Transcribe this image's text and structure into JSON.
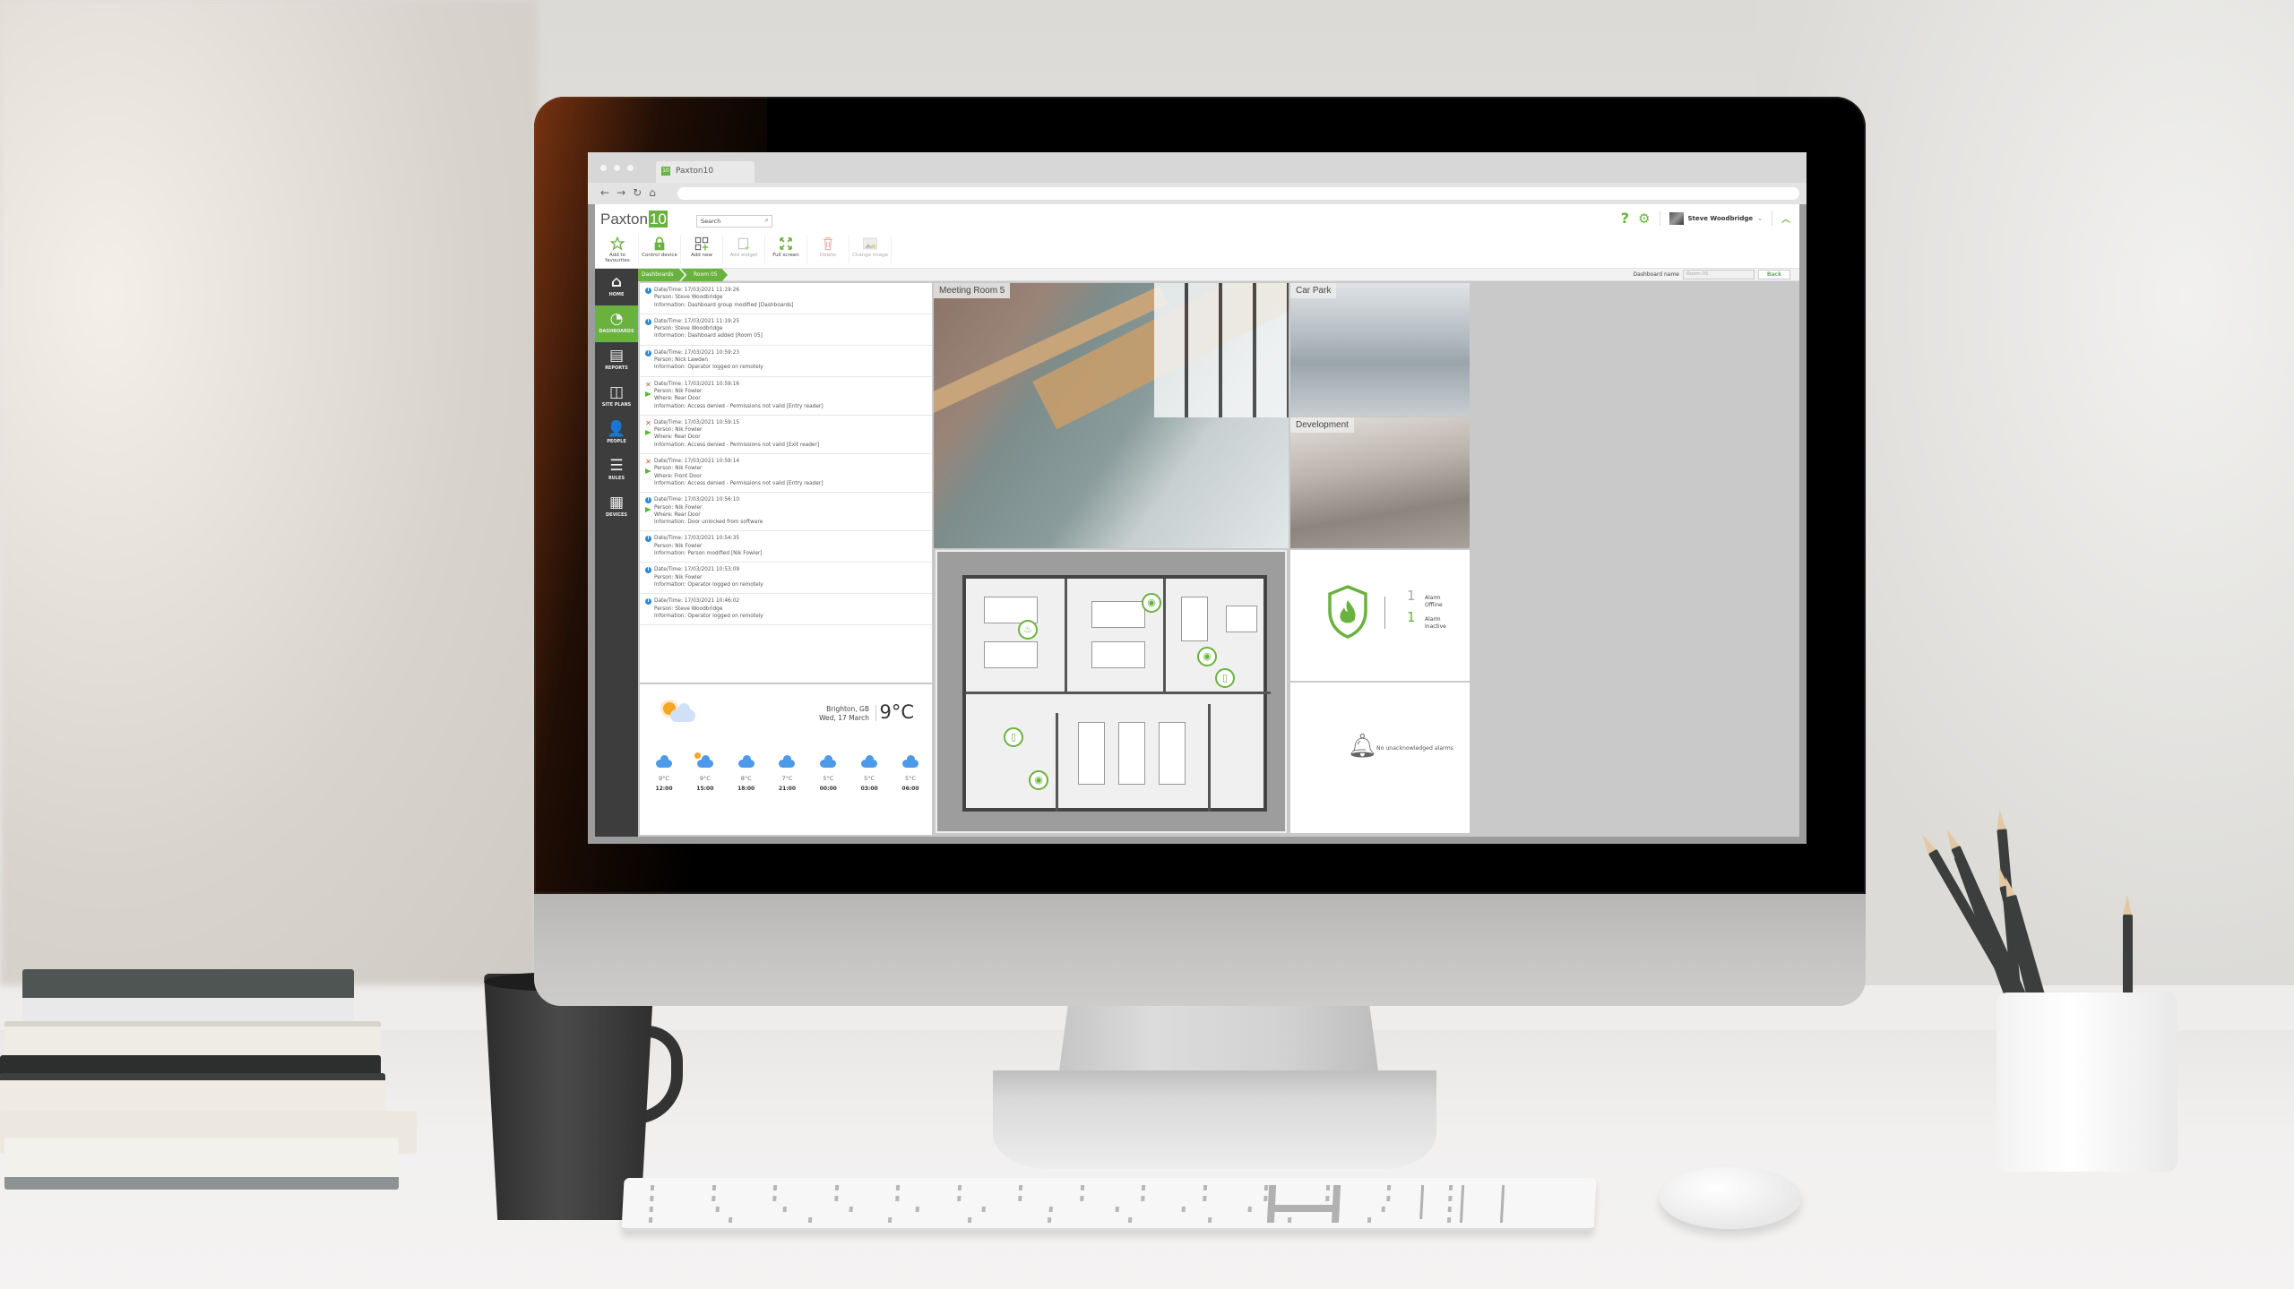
{
  "browser": {
    "tab_title": "Paxton10",
    "tab_favicon": "10",
    "nav": {
      "back": "←",
      "forward": "→",
      "reload": "↻",
      "home": "⌂"
    }
  },
  "app": {
    "logo_text": "Paxton",
    "logo_number": "10",
    "search_placeholder": "Search",
    "toolbar": [
      {
        "label": "Add to favourites",
        "icon": "star-icon",
        "enabled": true
      },
      {
        "label": "Control device",
        "icon": "lock-icon",
        "enabled": true
      },
      {
        "label": "Add new",
        "icon": "add-grid-icon",
        "enabled": true
      },
      {
        "label": "Add widget",
        "icon": "add-widget-icon",
        "enabled": false
      },
      {
        "label": "Full screen",
        "icon": "fullscreen-icon",
        "enabled": true
      },
      {
        "label": "Delete",
        "icon": "trash-icon",
        "enabled": false
      },
      {
        "label": "Change image",
        "icon": "image-icon",
        "enabled": false
      }
    ],
    "user_name": "Steve Woodbridge",
    "help_icon": "?",
    "accent_color": "#6ab23e"
  },
  "sidebar": {
    "items": [
      {
        "label": "HOME",
        "icon": "⌂",
        "active": false
      },
      {
        "label": "DASHBOARDS",
        "icon": "◔",
        "active": true
      },
      {
        "label": "REPORTS",
        "icon": "▤",
        "active": false
      },
      {
        "label": "SITE PLANS",
        "icon": "◫",
        "active": false
      },
      {
        "label": "PEOPLE",
        "icon": "👤",
        "active": false
      },
      {
        "label": "RULES",
        "icon": "☰",
        "active": false
      },
      {
        "label": "DEVICES",
        "icon": "▦",
        "active": false
      }
    ]
  },
  "breadcrumb": [
    "Dashboards",
    "Room 05"
  ],
  "dashboard": {
    "name_label": "Dashboard name",
    "name_value": "Room 05",
    "back_label": "Back"
  },
  "events": [
    {
      "type": "info",
      "lines": [
        "Date/Time: 17/03/2021 11:19:26",
        "Person: Steve Woodbridge",
        "Information: Dashboard group modified [Dashboards]"
      ]
    },
    {
      "type": "info",
      "lines": [
        "Date/Time: 17/03/2021 11:19:25",
        "Person: Steve Woodbridge",
        "Information: Dashboard added [Room 05]"
      ]
    },
    {
      "type": "info",
      "lines": [
        "Date/Time: 17/03/2021 10:59:23",
        "Person: Nick Lawden",
        "Information: Operator logged on remotely"
      ]
    },
    {
      "type": "denied",
      "lines": [
        "Date/Time: 17/03/2021 10:59:16",
        "Person: Nik Fowler",
        "Where: Rear Door",
        "Information: Access denied - Permissions not valid [Entry reader]"
      ]
    },
    {
      "type": "denied",
      "lines": [
        "Date/Time: 17/03/2021 10:59:15",
        "Person: Nik Fowler",
        "Where: Rear Door",
        "Information: Access denied - Permissions not valid [Exit reader]"
      ]
    },
    {
      "type": "denied",
      "lines": [
        "Date/Time: 17/03/2021 10:59:14",
        "Person: Nik Fowler",
        "Where: Front Door",
        "Information: Access denied - Permissions not valid [Entry reader]"
      ]
    },
    {
      "type": "info-door",
      "lines": [
        "Date/Time: 17/03/2021 10:56:10",
        "Person: Nik Fowler",
        "Where: Rear Door",
        "Information: Door unlocked from software"
      ]
    },
    {
      "type": "info",
      "lines": [
        "Date/Time: 17/03/2021 10:54:35",
        "Person: Nik Fowler",
        "Information: Person modified [Nik Fowler]"
      ]
    },
    {
      "type": "info",
      "lines": [
        "Date/Time: 17/03/2021 10:53:09",
        "Person: Nik Fowler",
        "Information: Operator logged on remotely"
      ]
    },
    {
      "type": "info",
      "lines": [
        "Date/Time: 17/03/2021 10:46:02",
        "Person: Steve Woodbridge",
        "Information: Operator logged on remotely"
      ]
    }
  ],
  "weather": {
    "location": "Brighton, GB",
    "date": "Wed, 17 March",
    "temperature": "9°C",
    "current_icon": "partly-sunny",
    "forecast": [
      {
        "temp": "9°C",
        "time": "12:00",
        "icon": "cloudy"
      },
      {
        "temp": "9°C",
        "time": "15:00",
        "icon": "sunny-showers"
      },
      {
        "temp": "8°C",
        "time": "18:00",
        "icon": "cloudy"
      },
      {
        "temp": "7°C",
        "time": "21:00",
        "icon": "cloudy"
      },
      {
        "temp": "5°C",
        "time": "00:00",
        "icon": "cloudy"
      },
      {
        "temp": "5°C",
        "time": "03:00",
        "icon": "cloudy"
      },
      {
        "temp": "5°C",
        "time": "06:00",
        "icon": "cloudy"
      }
    ]
  },
  "cameras": [
    {
      "label": "Meeting Room 5"
    },
    {
      "label": "Car Park"
    },
    {
      "label": "Development"
    }
  ],
  "fire_alarm": {
    "stats": [
      {
        "count": "1",
        "label_line1": "Alarm",
        "label_line2": "Offline",
        "color": "#aaaaaa"
      },
      {
        "count": "1",
        "label_line1": "Alarm",
        "label_line2": "Inactive",
        "color": "#6ab23e"
      }
    ]
  },
  "alarms": {
    "message": "No unacknowledged alarms"
  }
}
